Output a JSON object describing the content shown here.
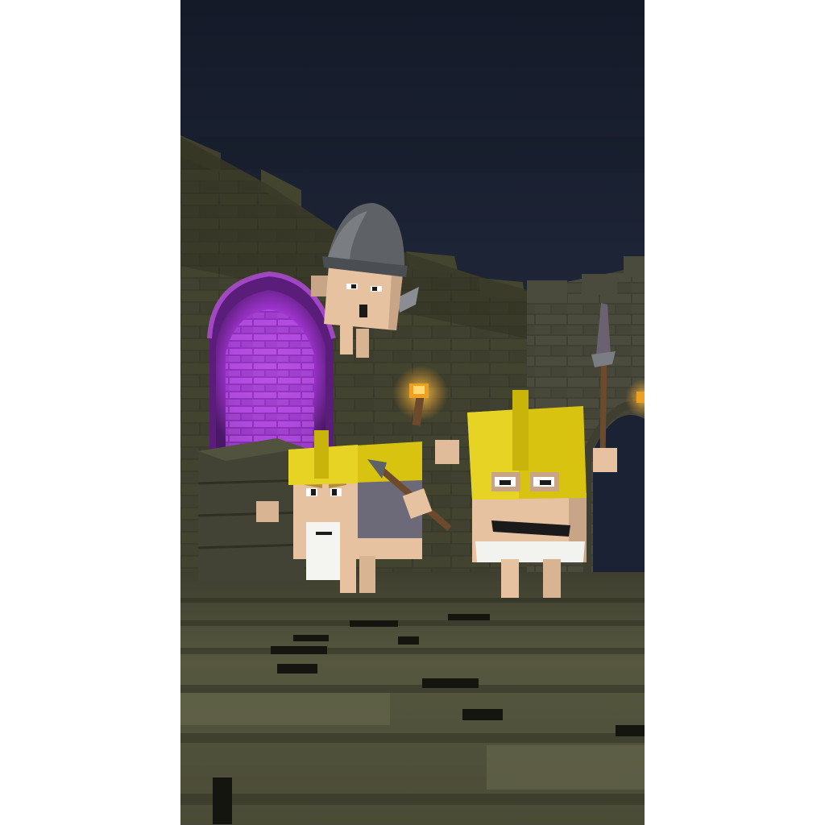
{
  "scene": {
    "kind": "voxel dungeon render",
    "colors": {
      "page_background": "#ffffff",
      "night_sky": "#1c2232",
      "wall_stone": "#3a3b2b",
      "floor_stone": "#56573f",
      "portal_glow": "#b640e0",
      "torch_flame": "#f0a020",
      "helmet_gold": "#d8c410",
      "helmet_iron": "#5e6165",
      "skin": "#e6c2a0",
      "loincloth": "#f2f2ee"
    },
    "elements": [
      "castle-wall",
      "crenellations",
      "magenta-portal-archway",
      "wall-torches",
      "iron-helmet-flying-character",
      "gold-helmet-bearded-warrior-with-spear",
      "gold-helmet-warrior-with-spear",
      "stone-block-floor",
      "stone-pillar-block"
    ]
  }
}
